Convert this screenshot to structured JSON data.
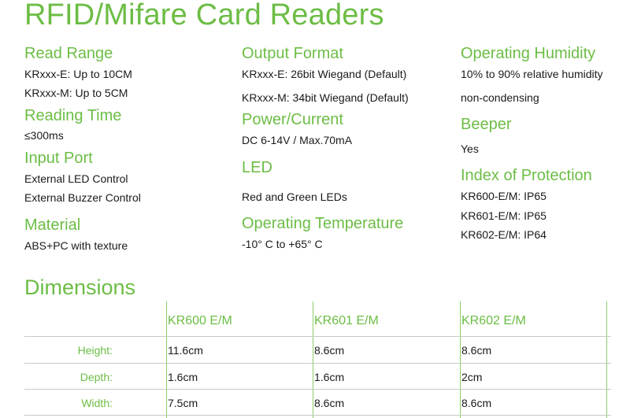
{
  "title": "RFID/Mifare Card Readers",
  "col1": {
    "read_range": {
      "heading": "Read Range",
      "lines": [
        "KRxxx-E: Up to 10CM",
        "KRxxx-M: Up to 5CM"
      ]
    },
    "reading_time": {
      "heading": "Reading Time",
      "lines": [
        "≤300ms"
      ]
    },
    "input_port": {
      "heading": "Input Port",
      "lines": [
        "External LED Control",
        "External Buzzer Control"
      ]
    },
    "material": {
      "heading": "Material",
      "lines": [
        "ABS+PC with texture"
      ]
    }
  },
  "col2": {
    "output_format": {
      "heading": "Output Format",
      "lines": [
        "KRxxx-E: 26bit Wiegand (Default)",
        "KRxxx-M: 34bit Wiegand (Default)"
      ]
    },
    "power": {
      "heading": "Power/Current",
      "lines": [
        "DC 6-14V / Max.70mA"
      ]
    },
    "led": {
      "heading": "LED",
      "lines": [
        "Red and Green LEDs"
      ]
    },
    "op_temp": {
      "heading": "Operating Temperature",
      "lines": [
        "-10° C  to  +65° C"
      ]
    }
  },
  "col3": {
    "op_humidity": {
      "heading": "Operating Humidity",
      "lines": [
        "10% to 90% relative humidity",
        "non-condensing"
      ]
    },
    "beeper": {
      "heading": "Beeper",
      "lines": [
        "Yes"
      ]
    },
    "protection": {
      "heading": "Index of Protection",
      "lines": [
        "KR600-E/M: IP65",
        "KR601-E/M: IP65",
        "KR602-E/M: IP64"
      ]
    }
  },
  "dimensions": {
    "title": "Dimensions",
    "columns": [
      "KR600 E/M",
      "KR601 E/M",
      "KR602 E/M"
    ],
    "rows": [
      {
        "label": "Height:",
        "values": [
          "11.6cm",
          "8.6cm",
          "8.6cm"
        ]
      },
      {
        "label": "Depth:",
        "values": [
          "1.6cm",
          "1.6cm",
          "2cm"
        ]
      },
      {
        "label": "Width:",
        "values": [
          "7.5cm",
          "8.6cm",
          "8.6cm"
        ]
      }
    ]
  },
  "colors": {
    "accent": "#6cbd45",
    "text": "#1a1a1a",
    "rule": "#c9c9c9"
  }
}
